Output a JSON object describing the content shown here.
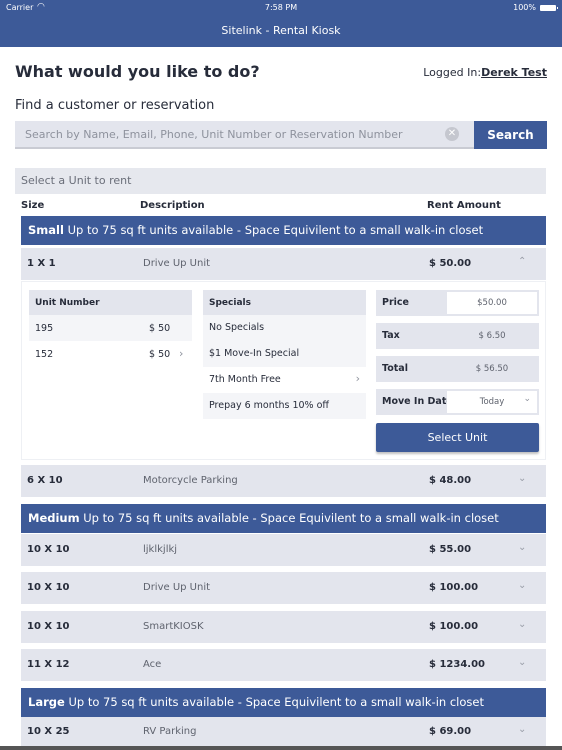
{
  "status_bar": {
    "carrier": "Carrier",
    "time": "7:58 PM",
    "battery": "100%"
  },
  "app": {
    "title": "Sitelink - Rental Kiosk"
  },
  "header": {
    "heading": "What would you like to do?",
    "logged_in_label": "Logged In:",
    "user_name": "Derek Test"
  },
  "search": {
    "label": "Find a customer or reservation",
    "placeholder": "Search by Name, Email, Phone, Unit Number or Reservation Number",
    "value": "",
    "button": "Search"
  },
  "unit_selection": {
    "title": "Select a Unit to rent",
    "columns": [
      "Size",
      "Description",
      "Rent Amount"
    ]
  },
  "groups": [
    {
      "name": "Small",
      "description": "Up to 75 sq ft units available - Space Equivilent to a small walk-in closet",
      "units": [
        {
          "size": "1 X 1",
          "description": "Drive Up Unit",
          "rent": "$ 50.00",
          "expanded": true
        },
        {
          "size": "6 X 10",
          "description": "Motorcycle Parking",
          "rent": "$ 48.00",
          "expanded": false
        }
      ]
    },
    {
      "name": "Medium",
      "description": "Up to 75 sq ft units available - Space Equivilent to a small walk-in closet",
      "units": [
        {
          "size": "10 X 10",
          "description": "ljklkjlkj",
          "rent": "$ 55.00",
          "expanded": false
        },
        {
          "size": "10 X 10",
          "description": "Drive Up Unit",
          "rent": "$ 100.00",
          "expanded": false
        },
        {
          "size": "10 X 10",
          "description": "SmartKIOSK",
          "rent": "$ 100.00",
          "expanded": false
        },
        {
          "size": "11 X 12",
          "description": "Ace",
          "rent": "$ 1234.00",
          "expanded": false
        }
      ]
    },
    {
      "name": "Large",
      "description": "Up to 75 sq ft units available - Space Equivilent to a small walk-in closet",
      "units": [
        {
          "size": "10 X 25",
          "description": "RV Parking",
          "rent": "$ 69.00",
          "expanded": false
        }
      ]
    }
  ],
  "detail": {
    "unit_number_header": "Unit Number",
    "unit_numbers": [
      {
        "number": "195",
        "amount": "$ 50"
      },
      {
        "number": "152",
        "amount": "$ 50"
      }
    ],
    "specials_header": "Specials",
    "specials": [
      "No Specials",
      "$1 Move-In Special",
      "7th Month Free",
      "Prepay 6 months 10% off"
    ],
    "price_label": "Price",
    "price_value": "$50.00",
    "tax_label": "Tax",
    "tax_value": "$ 6.50",
    "total_label": "Total",
    "total_value": "$ 56.50",
    "move_in_label": "Move In Date",
    "move_in_value": "Today",
    "select_button": "Select Unit"
  },
  "icons": {
    "wifi": "wifi-icon",
    "battery": "battery-icon",
    "clear": "clear-icon",
    "chevron_up": "chevron-up-icon",
    "chevron_down": "chevron-down-icon",
    "chevron_right": "chevron-right-icon"
  },
  "colors": {
    "brand": "#3d5a98",
    "row_bg": "#e3e5ed",
    "text_dark": "#272c3a"
  }
}
